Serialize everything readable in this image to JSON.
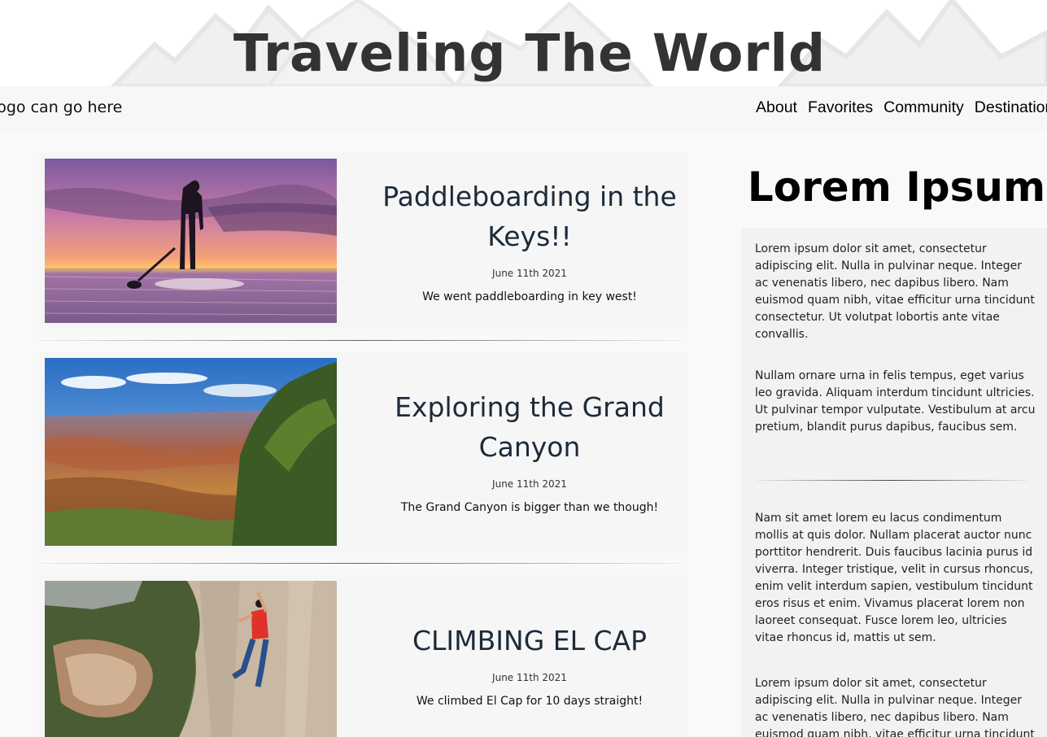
{
  "header": {
    "title": "Traveling The World"
  },
  "nav": {
    "logo_text": "Logo can go here",
    "links": [
      "About",
      "Favorites",
      "Community",
      "Destinations"
    ]
  },
  "posts": [
    {
      "title": "Paddleboarding in the Keys!!",
      "date": "June 11th 2021",
      "excerpt": "We went paddleboarding in key west!",
      "image": "paddleboard-sunset-photo"
    },
    {
      "title": "Exploring the Grand Canyon",
      "date": "June 11th 2021",
      "excerpt": "The Grand Canyon is bigger than we though!",
      "image": "grand-canyon-photo"
    },
    {
      "title": "CLIMBING EL CAP",
      "date": "June 11th 2021",
      "excerpt": "We climbed El Cap for 10 days straight!",
      "image": "el-cap-climber-photo"
    }
  ],
  "sidebar": {
    "heading": "Lorem Ipsum",
    "paragraphs": [
      "Lorem ipsum dolor sit amet, consectetur adipiscing elit. Nulla in pulvinar neque. Integer ac venenatis libero, nec dapibus libero. Nam euismod quam nibh, vitae efficitur urna tincidunt consectetur. Ut volutpat lobortis ante vitae convallis.",
      "Nullam ornare urna in felis tempus, eget varius leo gravida. Aliquam interdum tincidunt ultricies. Ut pulvinar tempor vulputate. Vestibulum at arcu pretium, blandit purus dapibus, faucibus sem.",
      "Nam sit amet lorem eu lacus condimentum mollis at quis dolor. Nullam placerat auctor nunc porttitor hendrerit. Duis faucibus lacinia purus id viverra. Integer tristique, velit in cursus rhoncus, enim velit interdum sapien, vestibulum tincidunt eros risus et enim. Vivamus placerat lorem non laoreet consequat. Fusce lorem leo, ultricies vitae rhoncus id, mattis ut sem.",
      "Lorem ipsum dolor sit amet, consectetur adipiscing elit. Nulla in pulvinar neque. Integer ac venenatis libero, nec dapibus libero. Nam euismod quam nibh, vitae efficitur urna tincidunt consectetur."
    ]
  },
  "colors": {
    "title_text": "#333333",
    "post_title": "#1c2a3a",
    "page_bg": "#f9f9f9"
  }
}
